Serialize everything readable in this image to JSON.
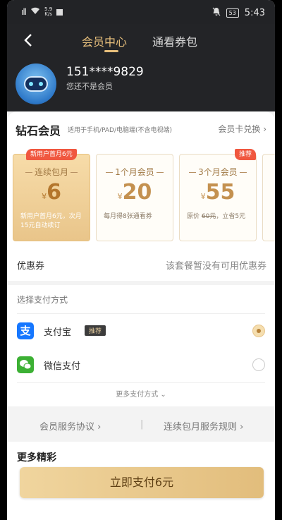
{
  "status_bar": {
    "signal": "ıll",
    "net_speed_value": "5.9",
    "net_speed_unit": "K/s",
    "battery": "53",
    "time": "5:43"
  },
  "header": {
    "back_icon": "‹",
    "tabs": [
      {
        "label": "会员中心",
        "active": true
      },
      {
        "label": "通看券包",
        "active": false
      }
    ],
    "user": {
      "phone": "151****9829",
      "status": "您还不是会员"
    }
  },
  "membership": {
    "tier_title": "钻石会员",
    "tier_desc": "适用于手机/PAD/电脑端(不含电视端)",
    "redeem_label": "会员卡兑换 ›",
    "plans": [
      {
        "badge": "新用户首月6元",
        "name": "连续包月",
        "currency": "¥",
        "price": "6",
        "note": "新用户首月6元，次月15元自动续订",
        "selected": true
      },
      {
        "badge": "",
        "name": "1个月会员",
        "currency": "¥",
        "price": "20",
        "note": "每月得8张通看券",
        "selected": false
      },
      {
        "badge": "推荐",
        "name": "3个月会员",
        "currency": "¥",
        "price": "55",
        "note_prefix": "原价",
        "note_strike": "60元",
        "note_suffix": "，立省5元",
        "selected": false
      }
    ],
    "coupon": {
      "label": "优惠券",
      "value": "该套餐暂没有可用优惠券"
    }
  },
  "payment": {
    "title": "选择支付方式",
    "methods": [
      {
        "name": "支付宝",
        "tag": "推荐",
        "icon": "alipay-icon",
        "selected": true
      },
      {
        "name": "微信支付",
        "tag": "",
        "icon": "wechat-pay-icon",
        "selected": false
      }
    ],
    "more_label": "更多支付方式 ⌄"
  },
  "agreements": {
    "service": "会员服务协议 ›",
    "auto_renew": "连续包月服务规则 ›"
  },
  "more": {
    "title": "更多精彩"
  },
  "cta": {
    "label": "立即支付6元"
  },
  "colors": {
    "accent_gold": "#e7bf7c",
    "header_bg": "#232427",
    "badge_red": "#f0573f"
  }
}
